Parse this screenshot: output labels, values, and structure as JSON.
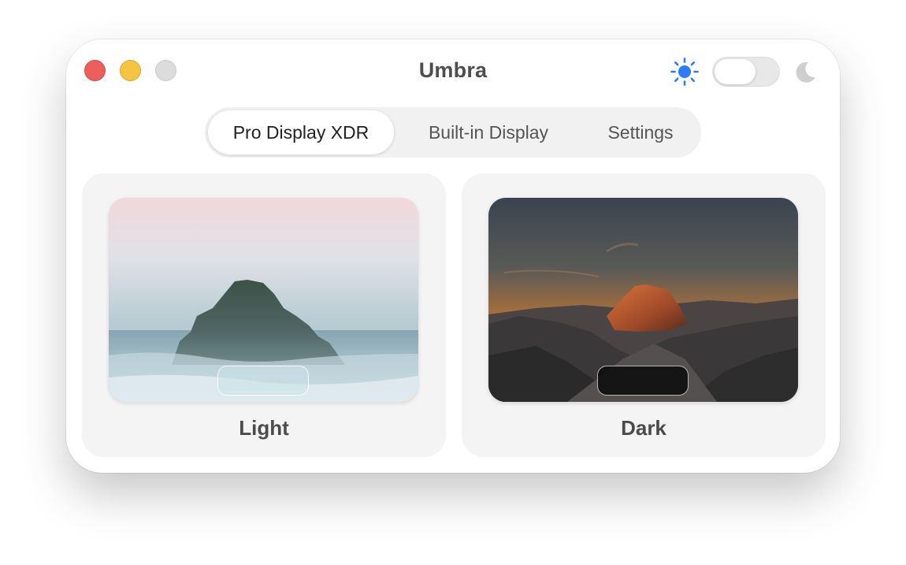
{
  "window": {
    "title": "Umbra"
  },
  "traffic_lights": {
    "close_color": "#ec5f5d",
    "minimize_color": "#f5c443",
    "zoom_color": "#dcdcdc"
  },
  "appearance_toggle": {
    "left_icon": "sun-icon",
    "right_icon": "moon-icon",
    "sun_color": "#2d7cf6",
    "state": "light"
  },
  "tabs": [
    {
      "label": "Pro Display XDR",
      "active": true
    },
    {
      "label": "Built-in Display",
      "active": false
    },
    {
      "label": "Settings",
      "active": false
    }
  ],
  "modes": [
    {
      "label": "Light",
      "image": "sea-rock-in-mist"
    },
    {
      "label": "Dark",
      "image": "half-dome-at-sunset"
    }
  ]
}
